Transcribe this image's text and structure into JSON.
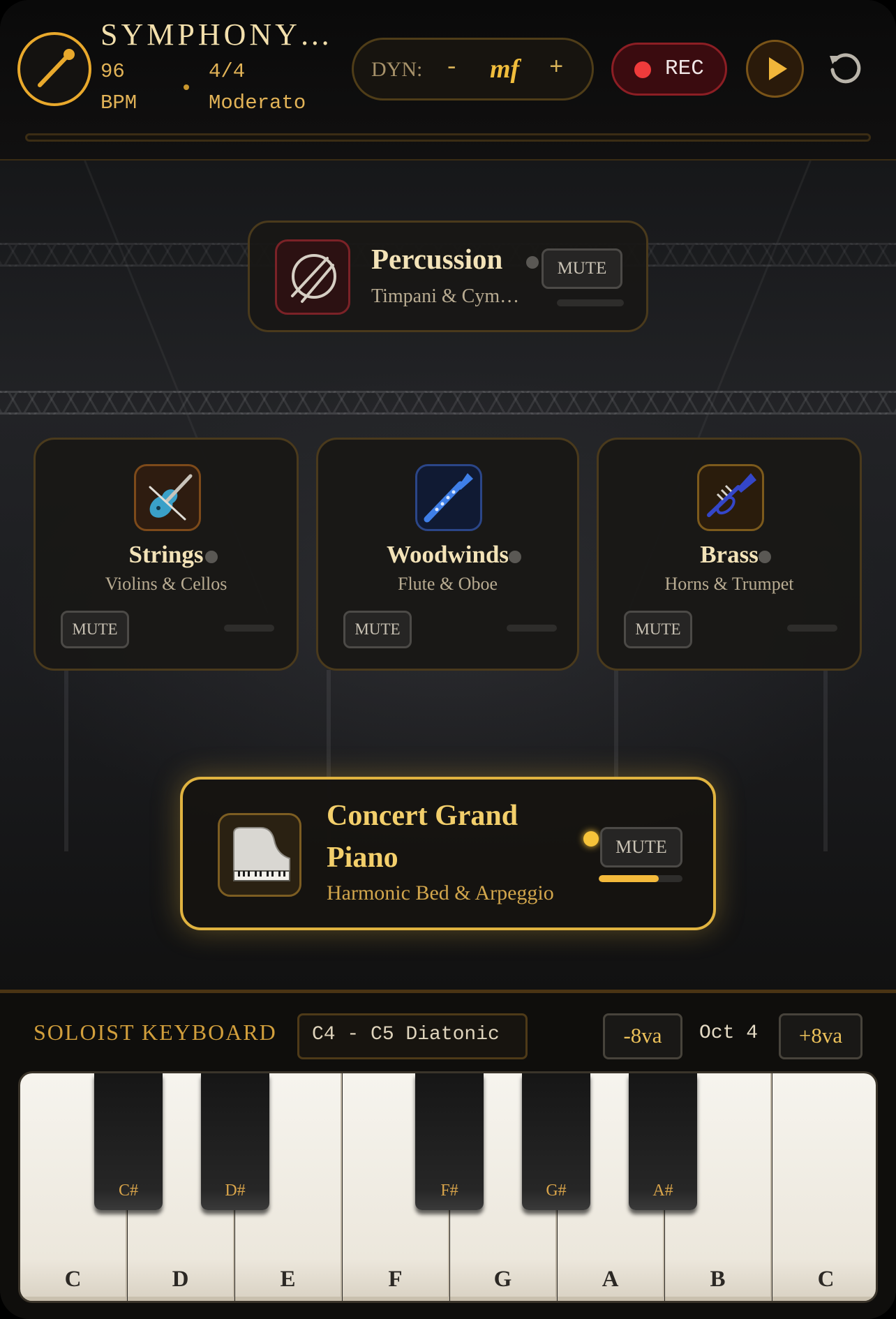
{
  "header": {
    "title": "SYMPHONY ...",
    "tempo": "96",
    "tempo_unit": "BPM",
    "time_signature": "4/4",
    "tempo_marking": "Moderato",
    "dynamics_label": "DYN:",
    "dynamics_decrease": "-",
    "dynamics_value": "mf",
    "dynamics_increase": "+",
    "record_label": "REC",
    "accent_color": "#e9a92c",
    "record_color": "#ef3b3b",
    "icons": {
      "conductor": "baton-icon",
      "play": "play-icon",
      "reset": "reset-icon"
    }
  },
  "sections": {
    "percussion": {
      "name": "Percussion",
      "subtitle": "Timpani & Cym…",
      "mute_label": "MUTE",
      "icon": "drum-icon",
      "active": false,
      "level": 0.0
    },
    "strings": {
      "name": "Strings",
      "subtitle": "Violins & Cellos",
      "mute_label": "MUTE",
      "icon": "violin-icon",
      "active": false,
      "level": 0.0
    },
    "woodwinds": {
      "name": "Woodwinds",
      "subtitle": "Flute & Oboe",
      "mute_label": "MUTE",
      "icon": "clarinet-icon",
      "active": false,
      "level": 0.0
    },
    "brass": {
      "name": "Brass",
      "subtitle": "Horns & Trumpet",
      "mute_label": "MUTE",
      "icon": "trumpet-icon",
      "active": false,
      "level": 0.0
    },
    "piano": {
      "name": "Concert Grand Piano",
      "subtitle": "Harmonic Bed & Arpeggio",
      "mute_label": "MUTE",
      "icon": "grand-piano-icon",
      "active": true,
      "level": 0.72,
      "active_color": "#f6c33a"
    }
  },
  "keyboard": {
    "label": "SOLOIST KEYBOARD",
    "range": "C4 - C5 Diatonic",
    "octave_down": "-8va",
    "octave_label": "Oct 4",
    "octave_up": "+8va",
    "white_keys": [
      "C",
      "D",
      "E",
      "F",
      "G",
      "A",
      "B",
      "C"
    ],
    "black_keys": [
      "C#",
      "D#",
      "F#",
      "G#",
      "A#"
    ]
  }
}
